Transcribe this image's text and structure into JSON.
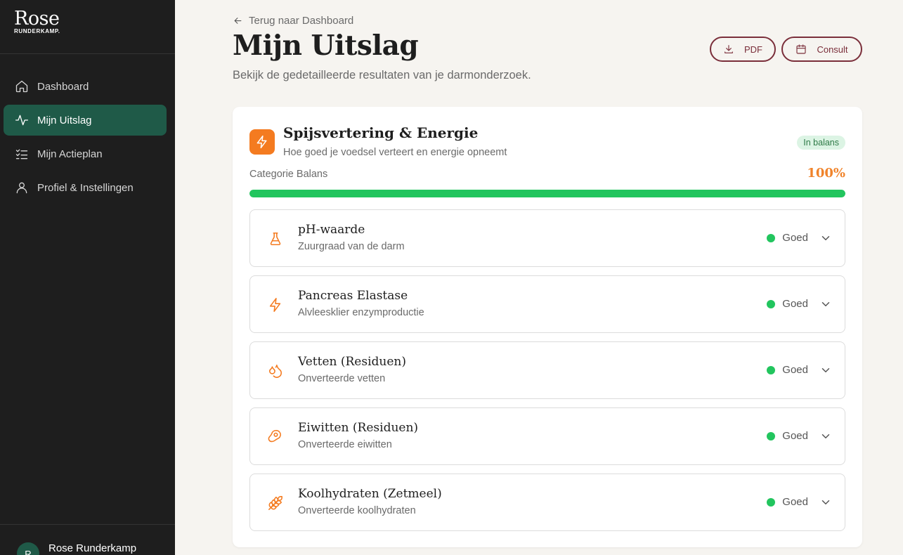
{
  "brand": {
    "name": "Rose",
    "tagline": "RUNDERKAMP."
  },
  "sidebar": {
    "items": [
      {
        "label": "Dashboard",
        "icon": "home-icon"
      },
      {
        "label": "Mijn Uitslag",
        "icon": "activity-icon",
        "active": true
      },
      {
        "label": "Mijn Actieplan",
        "icon": "checklist-icon"
      },
      {
        "label": "Profiel & Instellingen",
        "icon": "user-icon"
      }
    ],
    "user": {
      "initial": "R",
      "name": "Rose Runderkamp"
    }
  },
  "header": {
    "back_label": "Terug naar Dashboard",
    "title": "Mijn Uitslag",
    "subtitle": "Bekijk de gedetailleerde resultaten van je darmonderzoek.",
    "pdf_label": "PDF",
    "consult_label": "Consult"
  },
  "category": {
    "title": "Spijsvertering & Energie",
    "description": "Hoe goed je voedsel verteert en energie opneemt",
    "badge": "In balans",
    "balance_label": "Categorie Balans",
    "balance_value": "100%",
    "balance_fraction": 1.0
  },
  "items": [
    {
      "title": "pH-waarde",
      "subtitle": "Zuurgraad van de darm",
      "status": "Goed",
      "icon": "flask-icon"
    },
    {
      "title": "Pancreas Elastase",
      "subtitle": "Alvleesklier enzymproductie",
      "status": "Goed",
      "icon": "zap-icon"
    },
    {
      "title": "Vetten (Residuen)",
      "subtitle": "Onverteerde vetten",
      "status": "Goed",
      "icon": "droplets-icon"
    },
    {
      "title": "Eiwitten (Residuen)",
      "subtitle": "Onverteerde eiwitten",
      "status": "Goed",
      "icon": "beef-icon"
    },
    {
      "title": "Koolhydraten (Zetmeel)",
      "subtitle": "Onverteerde koolhydraten",
      "status": "Goed",
      "icon": "wheat-icon"
    }
  ],
  "colors": {
    "accent": "#f47b20",
    "brand": "#1f5a48",
    "button": "#7a2e3a",
    "good": "#22c55e"
  }
}
